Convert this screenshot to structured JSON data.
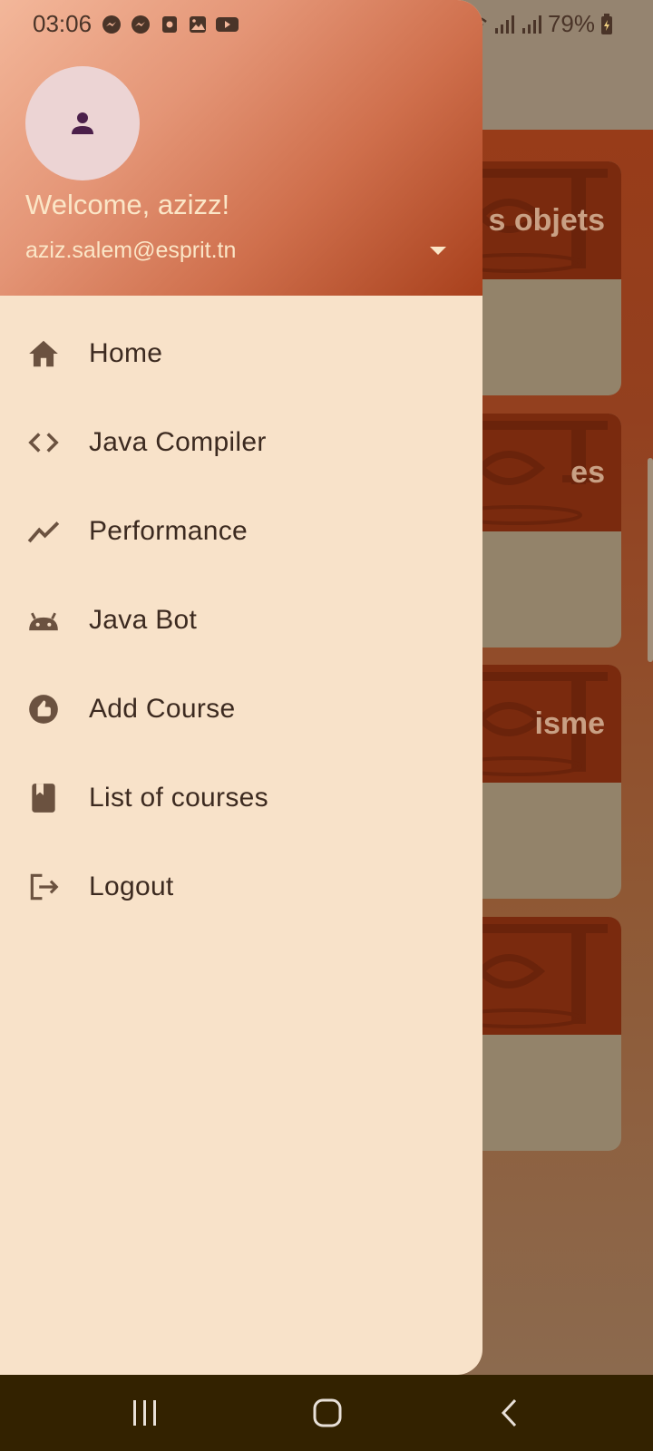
{
  "status_bar": {
    "time": "03:06",
    "battery": "79%",
    "notification_icons": [
      "messenger-icon",
      "messenger-icon",
      "screen-record-icon",
      "gallery-icon",
      "youtube-icon"
    ]
  },
  "drawer": {
    "welcome": "Welcome, azizz!",
    "email": "aziz.salem@esprit.tn",
    "items": [
      {
        "label": "Home",
        "icon": "home-icon"
      },
      {
        "label": "Java Compiler",
        "icon": "code-icon"
      },
      {
        "label": "Performance",
        "icon": "trending-icon"
      },
      {
        "label": "Java Bot",
        "icon": "android-icon"
      },
      {
        "label": "Add Course",
        "icon": "thumb-up-icon"
      },
      {
        "label": "List of courses",
        "icon": "book-icon"
      },
      {
        "label": "Logout",
        "icon": "logout-icon"
      }
    ]
  },
  "background": {
    "card_titles": [
      "s objets",
      "es",
      "isme",
      ""
    ]
  },
  "colors": {
    "drawer_bg": "#f8e2c9",
    "header_gradient_start": "#f3b79a",
    "header_gradient_end": "#a8401c",
    "nav_bar": "#332200",
    "icon": "#6b5240"
  }
}
